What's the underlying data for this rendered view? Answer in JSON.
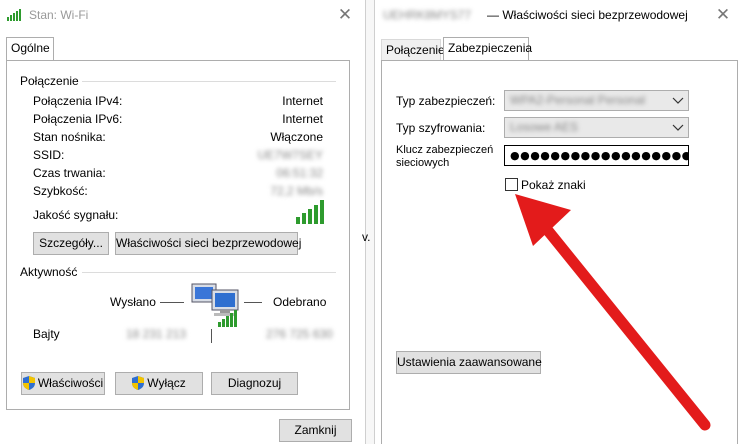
{
  "left_window": {
    "title": "Stan: Wi-Fi",
    "tab_general": "Ogólne",
    "connection_group": "Połączenie",
    "rows": [
      {
        "label": "Połączenia IPv4:",
        "value": "Internet"
      },
      {
        "label": "Połączenia IPv6:",
        "value": "Internet"
      },
      {
        "label": "Stan nośnika:",
        "value": "Włączone"
      },
      {
        "label": "SSID:",
        "value": "UE7W7SEY"
      },
      {
        "label": "Czas trwania:",
        "value": "06:51:32"
      },
      {
        "label": "Szybkość:",
        "value": "72,2 Mb/s"
      }
    ],
    "signal_label": "Jakość sygnału:",
    "signal_bars": 5,
    "details_button": "Szczegóły...",
    "wireless_props_button": "Właściwości sieci bezprzewodowej",
    "activity_group": "Aktywność",
    "sent_label": "Wysłano",
    "received_label": "Odebrano",
    "bytes_label": "Bajty",
    "bytes_sent": "18 231 213",
    "bytes_received": "276 725 630",
    "properties_button": "Właściwości",
    "disable_button": "Wyłącz",
    "diagnose_button": "Diagnozuj",
    "close_button": "Zamknij"
  },
  "middle_fragment": "v.",
  "right_window": {
    "title_network": "UEHRK8MYS77",
    "title_suffix": "— Właściwości sieci bezprzewodowej",
    "tab_connection": "Połączenie",
    "tab_security": "Zabezpieczenia",
    "security_type_label": "Typ zabezpieczeń:",
    "security_type_value": "WPA2-Personal Personal",
    "encryption_type_label": "Typ szyfrowania:",
    "encryption_type_value": "Losowe AES",
    "network_key_label_1": "Klucz zabezpieczeń",
    "network_key_label_2": "sieciowych",
    "network_key_value": "●●●●●●●●●●●●●●●●●●●●●●●",
    "show_chars_label": "Pokaż znaki",
    "advanced_button": "Ustawienia zaawansowane"
  },
  "colors": {
    "signal_green": "#2e9b2e",
    "arrow_red": "#e31b1b",
    "button_face": "#e1e1e1",
    "border": "#adadad",
    "shield_blue": "#2f6fd0",
    "shield_yellow": "#f2c400"
  }
}
